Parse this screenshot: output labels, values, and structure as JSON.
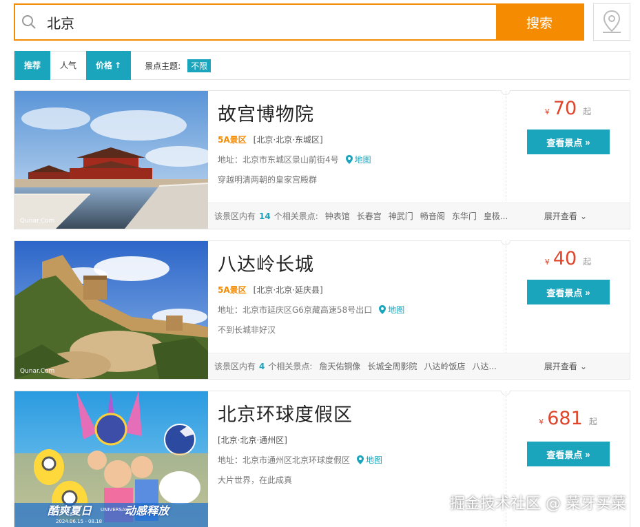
{
  "search": {
    "value": "北京",
    "button_label": "搜索"
  },
  "filter": {
    "sorts": [
      "推荐",
      "人气",
      "价格"
    ],
    "price_arrow": "↑",
    "theme_label": "景点主题:",
    "theme_value": "不限"
  },
  "cards": [
    {
      "title": "故宫博物院",
      "level": "5A景区",
      "region": "[北京·北京·东城区]",
      "address": "地址：北京市东城区景山前街4号",
      "map_label": "地图",
      "desc": "穿越明清两朝的皇家宫殿群",
      "price_symbol": "¥",
      "price": "70",
      "price_suffix": "起",
      "view_label": "查看景点",
      "related_prefix": "该景区内有",
      "related_count": "14",
      "related_suffix": "个相关景点:",
      "related_spots": [
        "钟表馆",
        "长春宫",
        "神武门",
        "畅音阁",
        "东华门",
        "皇极..."
      ],
      "expand_label": "展开查看",
      "img_credit": "Qunar.Com"
    },
    {
      "title": "八达岭长城",
      "level": "5A景区",
      "region": "[北京·北京·延庆县]",
      "address": "地址：北京市延庆区G6京藏高速58号出口",
      "map_label": "地图",
      "desc": "不到长城非好汉",
      "price_symbol": "¥",
      "price": "40",
      "price_suffix": "起",
      "view_label": "查看景点",
      "related_prefix": "该景区内有",
      "related_count": "4",
      "related_suffix": "个相关景点:",
      "related_spots": [
        "詹天佑铜像",
        "长城全周影院",
        "八达岭饭店",
        "八达..."
      ],
      "expand_label": "展开查看",
      "img_credit": "Qunar.Com"
    },
    {
      "title": "北京环球度假区",
      "level": "",
      "region": "[北京·北京·通州区]",
      "address": "地址：北京市通州区北京环球度假区",
      "map_label": "地图",
      "desc": "大片世界，在此成真",
      "price_symbol": "¥",
      "price": "681",
      "price_suffix": "起",
      "view_label": "查看景点",
      "img_text_left": "酷爽夏日",
      "img_text_right": "动感释放",
      "img_dates": "2024.06.15 - 08.18",
      "img_brand": "UNIVERSAL"
    }
  ],
  "watermark": "掘金技术社区 @ 菜牙买菜"
}
